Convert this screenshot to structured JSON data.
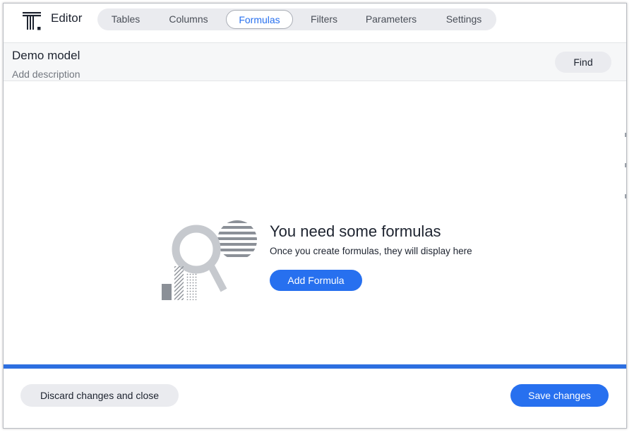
{
  "header": {
    "title": "Editor",
    "tabs": [
      {
        "label": "Tables",
        "active": false
      },
      {
        "label": "Columns",
        "active": false
      },
      {
        "label": "Formulas",
        "active": true
      },
      {
        "label": "Filters",
        "active": false
      },
      {
        "label": "Parameters",
        "active": false
      },
      {
        "label": "Settings",
        "active": false
      }
    ]
  },
  "model": {
    "name": "Demo model",
    "description_placeholder": "Add description",
    "find_label": "Find"
  },
  "empty_state": {
    "title": "You need some formulas",
    "subtitle": "Once you create formulas, they will display here",
    "button_label": "Add Formula",
    "illustration": "magnifier-illustration"
  },
  "footer": {
    "discard_label": "Discard changes and close",
    "save_label": "Save changes"
  },
  "colors": {
    "accent": "#2770ef",
    "progress_bar": "#2d6fe0",
    "illustration_gray": "#c6c9ce",
    "illustration_dark": "#8b9097"
  }
}
